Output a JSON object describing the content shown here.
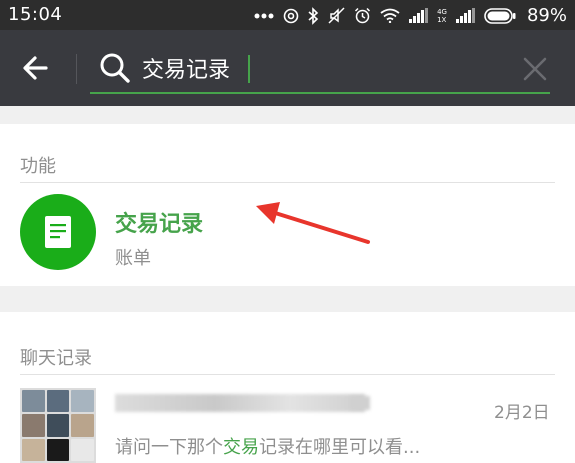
{
  "status_bar": {
    "time": "15:04",
    "battery": "89%",
    "network_top": "4G",
    "network_bottom": "1X",
    "icons": [
      "more-dots-icon",
      "wechat-ring-icon",
      "bluetooth-icon",
      "mute-icon",
      "alarm-icon",
      "wifi-icon",
      "signal-icon",
      "signal-icon",
      "battery-icon"
    ]
  },
  "header": {
    "back_icon": "back-arrow-icon",
    "search_icon": "search-icon",
    "search_value": "交易记录",
    "clear_icon": "close-icon"
  },
  "functions_section": {
    "title": "功能",
    "item": {
      "icon": "document-icon",
      "title": "交易记录",
      "subtitle": "账单"
    }
  },
  "annotation": {
    "arrow_color": "#e8352c"
  },
  "chat_section": {
    "title": "聊天记录",
    "item": {
      "date": "2月2日",
      "preview_before": "请问一下那个",
      "preview_highlight": "交易",
      "preview_after": "记录在哪里可以看..."
    }
  },
  "colors": {
    "header_bg": "#393a3f",
    "status_bg": "#2d2d2d",
    "accent_green": "#46a34b",
    "avatar_green": "#1aad19",
    "muted_text": "#8f8f8f"
  }
}
